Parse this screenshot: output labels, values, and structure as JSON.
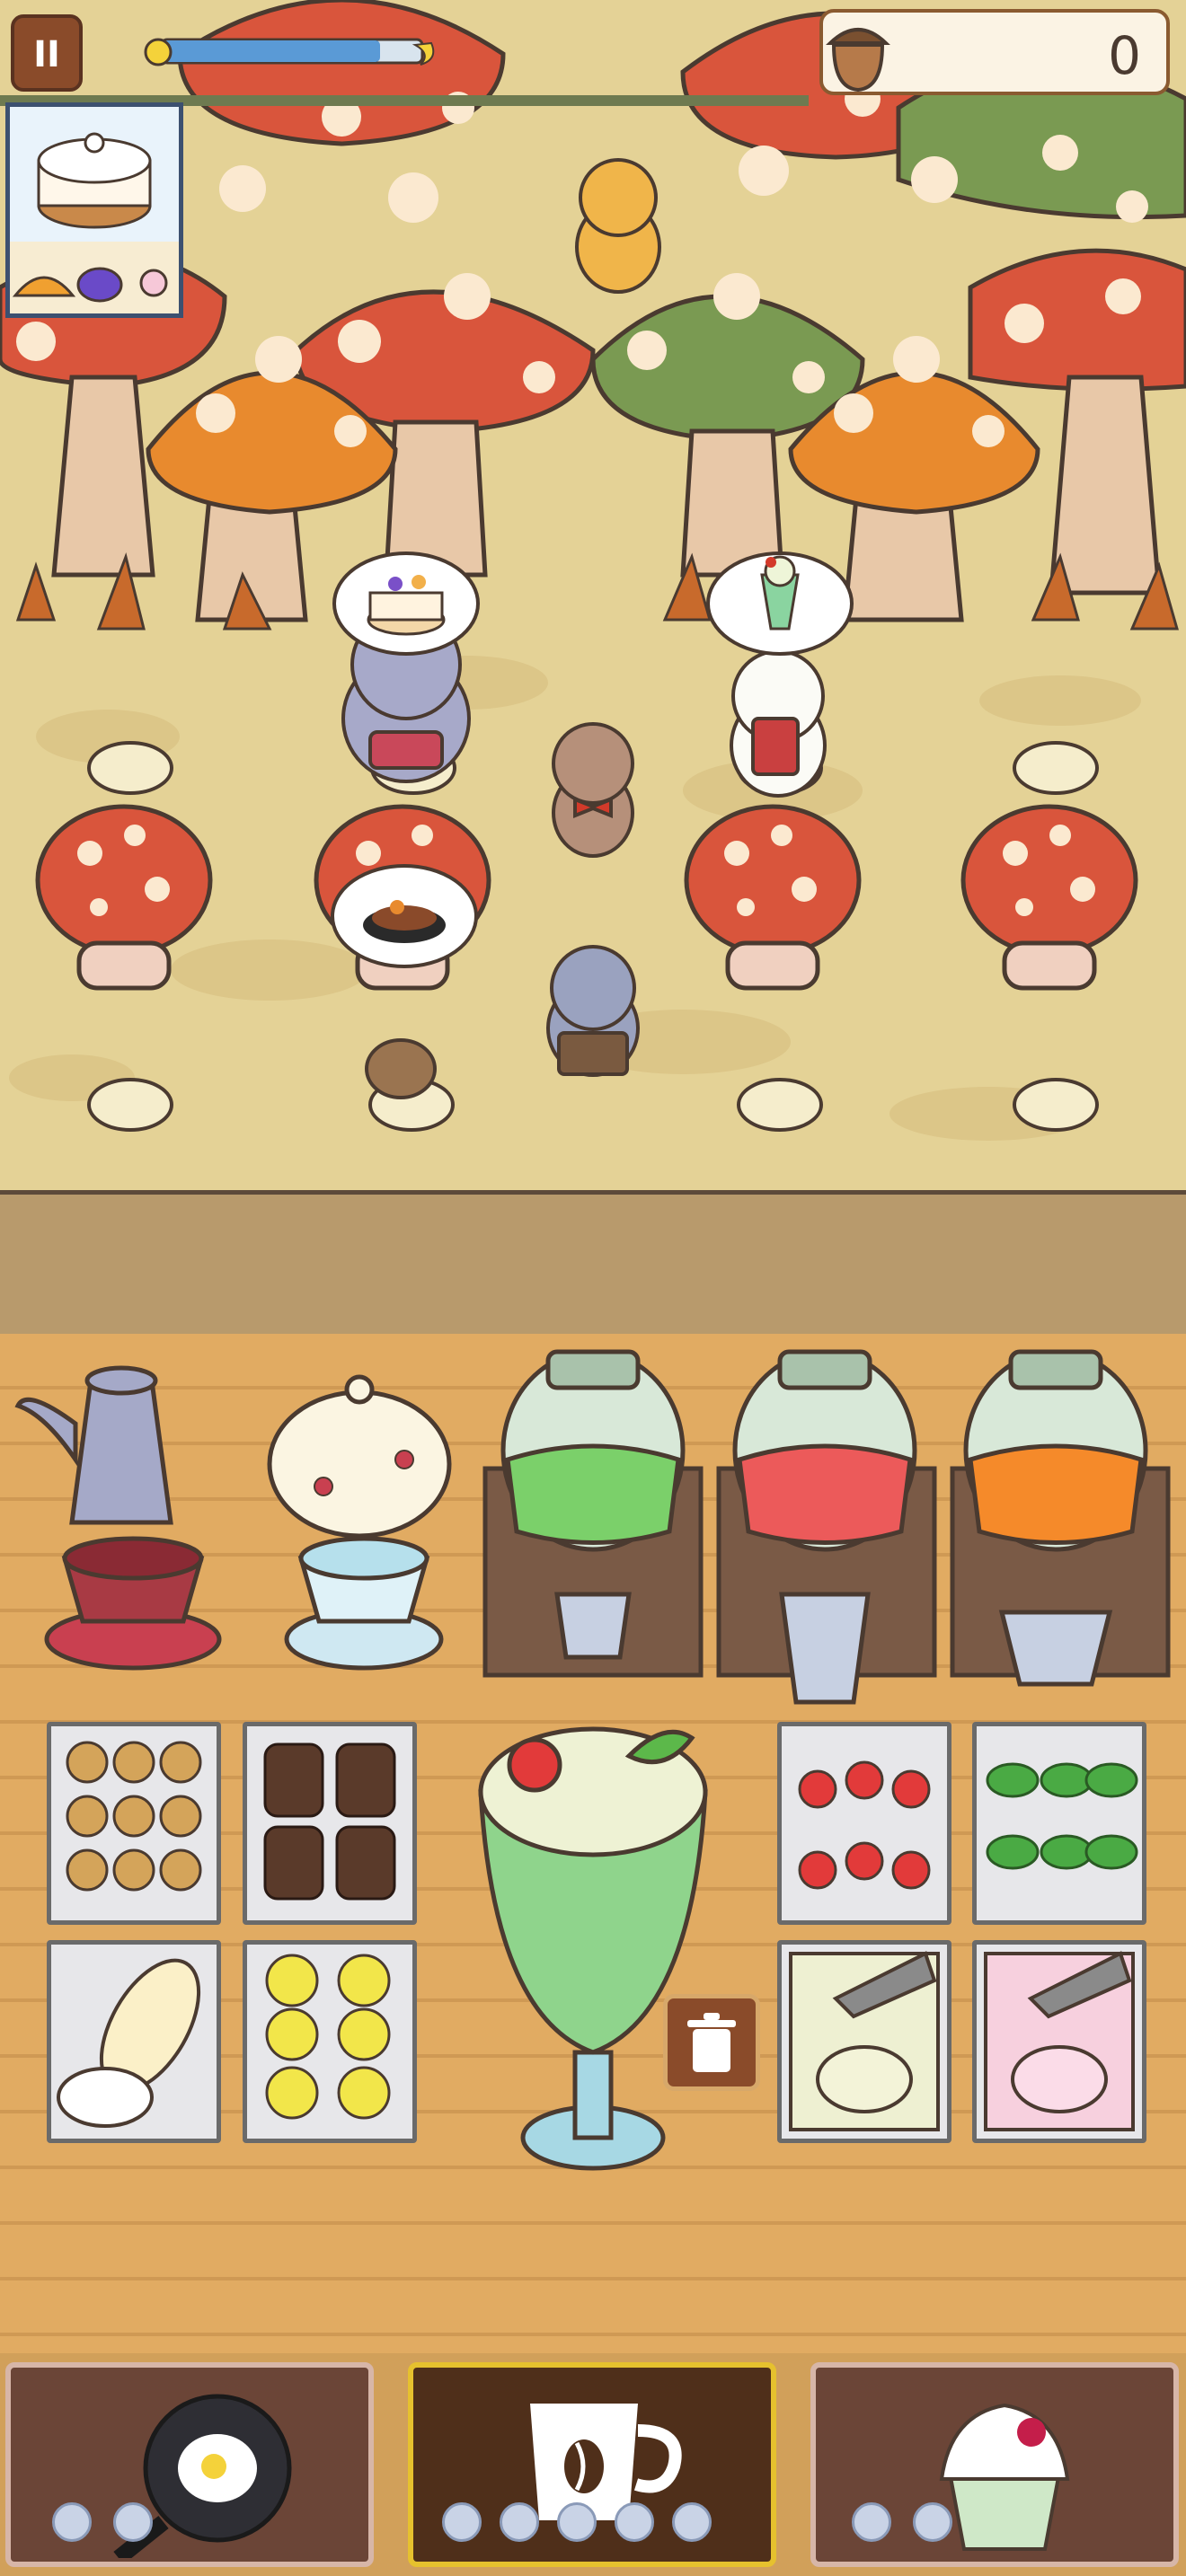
{
  "hud": {
    "pause_icon": "pause-icon",
    "acorn_count": "0",
    "day_progress": 0.84,
    "colors": {
      "sky_bar": "#5a9ad6",
      "sun": "#f4d23a",
      "acorn_box": "#fbf3e4"
    }
  },
  "order": {
    "dish_icon": "cake-icon",
    "toppings": [
      "orange-slice-icon",
      "blueberry-icon",
      "flower-icon"
    ]
  },
  "customers": [
    {
      "name": "elephant",
      "order_icon": "cake-icon"
    },
    {
      "name": "white-cat",
      "order_icon": "melon-soda-icon"
    },
    {
      "name": "bird",
      "order_icon": "steak-plate-icon"
    }
  ],
  "staff": [
    "chipmunk",
    "bear-waiter",
    "raccoon-chef"
  ],
  "counter": {
    "drinks": [
      "blue-coffee-pot-icon",
      "floral-teapot-icon",
      "green-juice-jar-icon",
      "strawberry-juice-jar-icon",
      "orange-juice-jar-icon"
    ],
    "cups": [
      "red-coffee-cup-icon",
      "blue-tea-cup-icon",
      "small-glass-icon",
      "tall-glass-icon",
      "bowl-glass-icon"
    ],
    "bins": [
      "paw-cookie-bin",
      "bear-chocolate-bin",
      "cherry-bin",
      "mint-leaf-bin",
      "whipped-cream-bin",
      "lemon-slice-bin",
      "melon-ice-cream-bin",
      "strawberry-ice-cream-bin"
    ],
    "current_dish": "cream-soda-float-icon",
    "trash_icon": "trash-icon"
  },
  "stations": [
    {
      "name": "kitchen",
      "icon": "frying-pan-egg-icon",
      "dots": 2,
      "active": false
    },
    {
      "name": "cafe",
      "icon": "coffee-cup-icon",
      "dots": 5,
      "active": true
    },
    {
      "name": "bakery",
      "icon": "cupcake-icon",
      "dots": 2,
      "active": false
    }
  ]
}
